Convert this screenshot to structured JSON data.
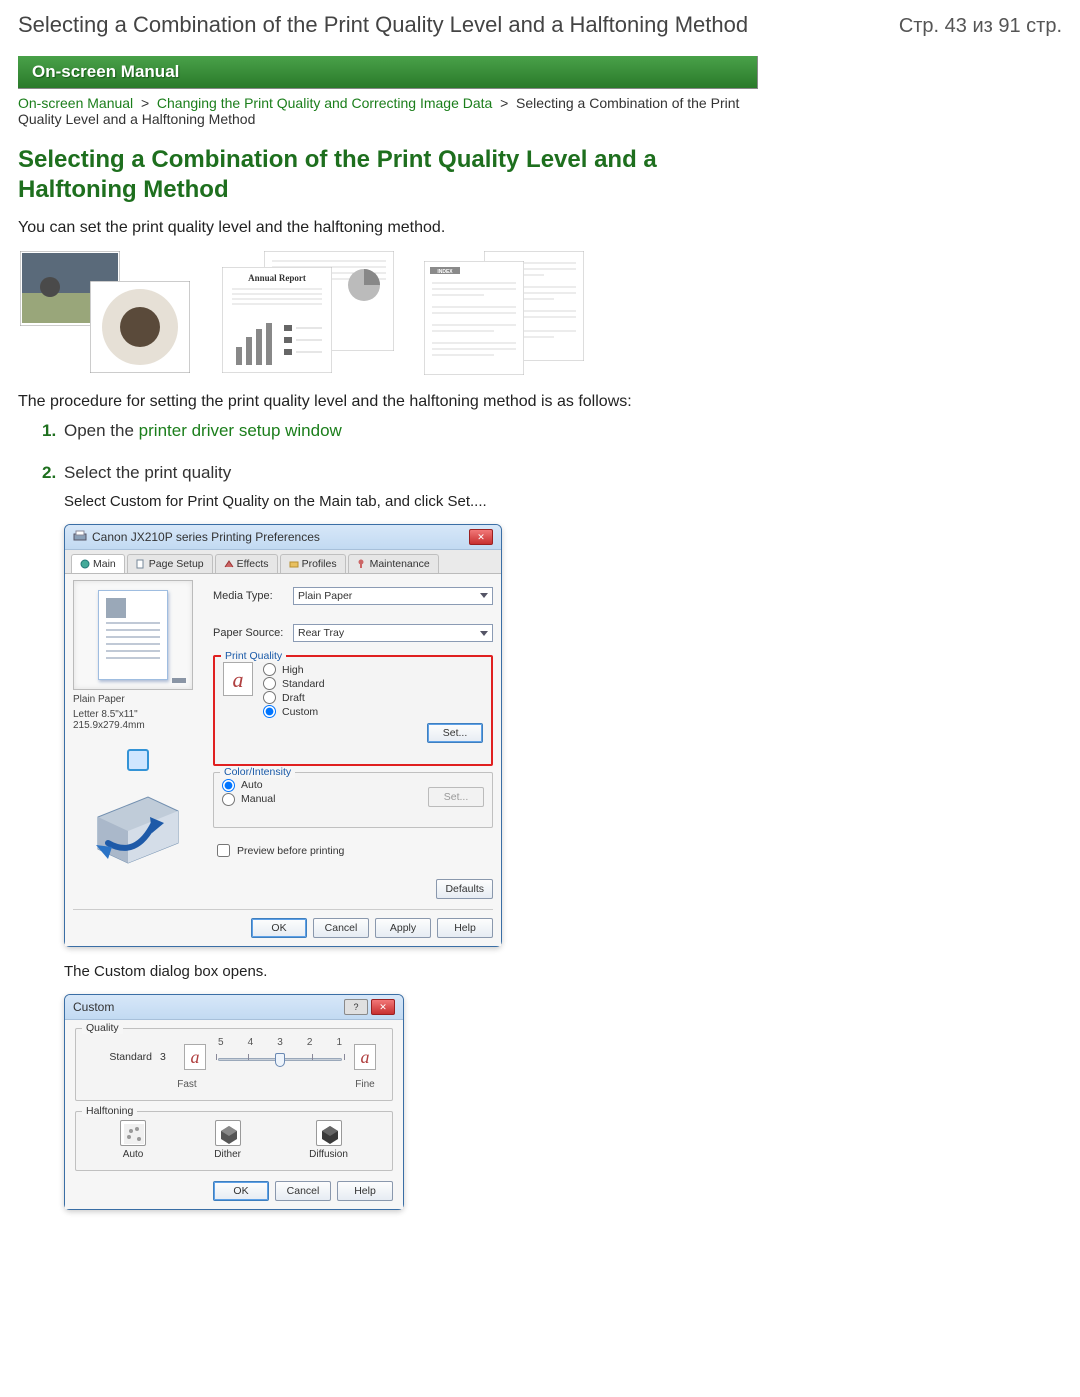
{
  "header": {
    "doc_title": "Selecting a Combination of the Print Quality Level and a Halftoning Method",
    "page_counter": "Стр. 43 из 91 стр."
  },
  "manual_bar": "On-screen Manual",
  "breadcrumb": {
    "root": "On-screen Manual",
    "mid": "Changing the Print Quality and Correcting Image Data",
    "tail": "Selecting a Combination of the Print Quality Level and a Halftoning Method"
  },
  "main_heading": "Selecting a Combination of the Print Quality Level and a Halftoning Method",
  "intro1": "You can set the print quality level and the halftoning method.",
  "intro2": "The procedure for setting the print quality level and the halftoning method is as follows:",
  "steps": [
    {
      "prefix": "Open the ",
      "link": "printer driver setup window"
    },
    {
      "title": "Select the print quality",
      "body": "Select Custom for Print Quality on the Main tab, and click Set...."
    }
  ],
  "dlg1": {
    "window_title": "Canon JX210P series Printing Preferences",
    "tabs": [
      "Main",
      "Page Setup",
      "Effects",
      "Profiles",
      "Maintenance"
    ],
    "media_type_label": "Media Type:",
    "media_type_value": "Plain Paper",
    "paper_source_label": "Paper Source:",
    "paper_source_value": "Rear Tray",
    "print_quality_label": "Print Quality",
    "pq_options": {
      "high": "High",
      "standard": "Standard",
      "draft": "Draft",
      "custom": "Custom"
    },
    "set_btn": "Set...",
    "color_intensity_label": "Color/Intensity",
    "ci_options": {
      "auto": "Auto",
      "manual": "Manual"
    },
    "ci_set_btn": "Set...",
    "preview_check": "Preview before printing",
    "paper_info1": "Plain Paper",
    "paper_info2": "Letter 8.5\"x11\" 215.9x279.4mm",
    "defaults_btn": "Defaults",
    "footer_btns": {
      "ok": "OK",
      "cancel": "Cancel",
      "apply": "Apply",
      "help": "Help"
    }
  },
  "after_dlg1": "The Custom dialog box opens.",
  "dlg2": {
    "window_title": "Custom",
    "quality_group": "Quality",
    "quality_value_label": "Standard",
    "quality_value_num": "3",
    "tick_labels": [
      "5",
      "4",
      "3",
      "2",
      "1"
    ],
    "end_fast": "Fast",
    "end_fine": "Fine",
    "halftoning_group": "Halftoning",
    "halftoning_options": {
      "auto": "Auto",
      "dither": "Dither",
      "diffusion": "Diffusion"
    },
    "footer_btns": {
      "ok": "OK",
      "cancel": "Cancel",
      "help": "Help"
    }
  },
  "sample_docs": {
    "annual_report": "Annual Report",
    "index": "INDEX"
  }
}
